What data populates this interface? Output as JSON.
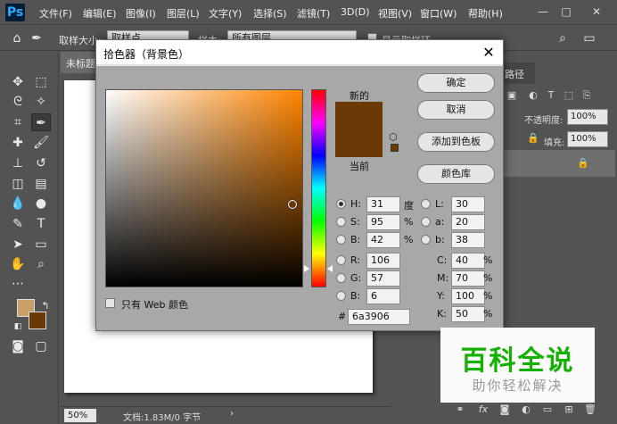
{
  "app": {
    "logo": "Ps"
  },
  "menu": [
    "文件(F)",
    "编辑(E)",
    "图像(I)",
    "图层(L)",
    "文字(Y)",
    "选择(S)",
    "滤镜(T)",
    "3D(D)",
    "视图(V)",
    "窗口(W)",
    "帮助(H)"
  ],
  "window_controls": {
    "minimize": "—",
    "maximize": "□",
    "close": "✕"
  },
  "options_bar": {
    "sample_size_label": "取样大小:",
    "sample_size_value": "取样点",
    "sample_label": "样本:",
    "sample_value": "所有图层",
    "show_ring_label": "显示取样环"
  },
  "document": {
    "tab": "未标题",
    "zoom": "50%",
    "doc_info": "文档:1.83M/0 字节"
  },
  "right_panel": {
    "tab": "路径",
    "opacity_label": "不透明度:",
    "opacity_value": "100%",
    "fill_label": "填充:",
    "fill_value": "100%"
  },
  "dialog": {
    "title": "拾色器（背景色）",
    "close": "✕",
    "new_label": "新的",
    "current_label": "当前",
    "new_color": "#6a3906",
    "current_color": "#6a3906",
    "hue_color": "#ff8400",
    "picker_position": {
      "saturation": 95,
      "brightness": 42
    },
    "hue_value": 31,
    "buttons": {
      "ok": "确定",
      "cancel": "取消",
      "add_swatch": "添加到色板",
      "color_library": "颜色库"
    },
    "web_only_label": "只有 Web 颜色",
    "hsb": [
      {
        "key": "H:",
        "value": "31",
        "unit": "度",
        "selected": true
      },
      {
        "key": "S:",
        "value": "95",
        "unit": "%",
        "selected": false
      },
      {
        "key": "B:",
        "value": "42",
        "unit": "%",
        "selected": false
      }
    ],
    "rgb": [
      {
        "key": "R:",
        "value": "106",
        "selected": false
      },
      {
        "key": "G:",
        "value": "57",
        "selected": false
      },
      {
        "key": "B:",
        "value": "6",
        "selected": false
      }
    ],
    "lab": [
      {
        "key": "L:",
        "value": "30",
        "selected": false
      },
      {
        "key": "a:",
        "value": "20",
        "selected": false
      },
      {
        "key": "b:",
        "value": "38",
        "selected": false
      }
    ],
    "cmyk": [
      {
        "key": "C:",
        "value": "40",
        "unit": "%"
      },
      {
        "key": "M:",
        "value": "70",
        "unit": "%"
      },
      {
        "key": "Y:",
        "value": "100",
        "unit": "%"
      },
      {
        "key": "K:",
        "value": "50",
        "unit": "%"
      }
    ],
    "hex_label": "#",
    "hex_value": "6a3906"
  },
  "toolbar": {
    "foreground_color": "#c9a06a",
    "background_color": "#6a3906"
  },
  "watermark": {
    "main": "百科全说",
    "sub": "助你轻松解决"
  }
}
